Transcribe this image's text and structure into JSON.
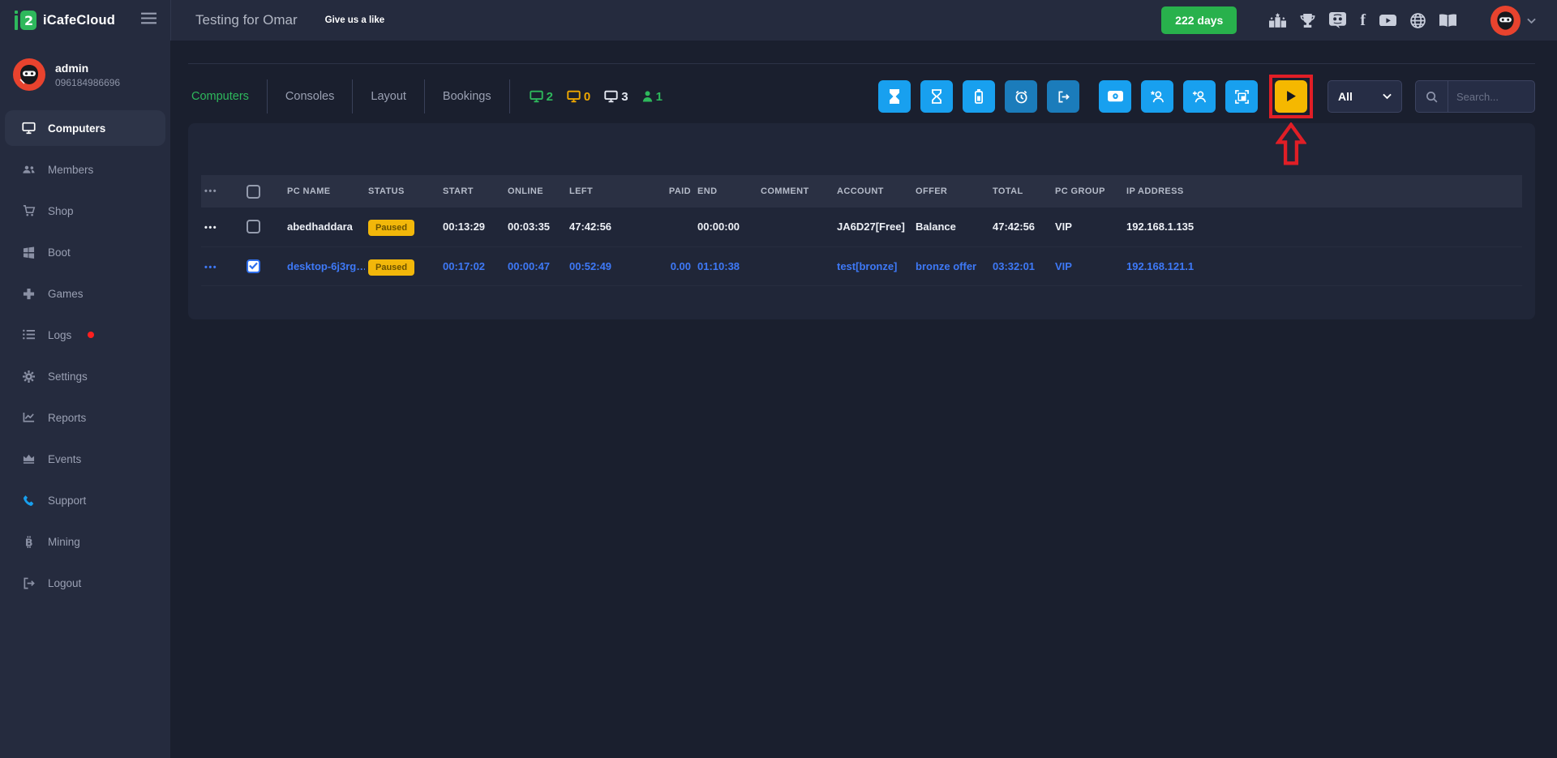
{
  "brand": {
    "name": "iCafeCloud"
  },
  "header": {
    "title": "Testing for Omar",
    "like": "Give us a like",
    "days_badge": "222 days",
    "social_icons": [
      "ranking",
      "trophy",
      "discord",
      "facebook",
      "youtube",
      "globe",
      "guide-book"
    ]
  },
  "user": {
    "name": "admin",
    "phone": "096184986696"
  },
  "sidebar": [
    {
      "label": "Computers",
      "icon": "monitor",
      "active": true
    },
    {
      "label": "Members",
      "icon": "people"
    },
    {
      "label": "Shop",
      "icon": "cart"
    },
    {
      "label": "Boot",
      "icon": "windows"
    },
    {
      "label": "Games",
      "icon": "gamepad"
    },
    {
      "label": "Logs",
      "icon": "list",
      "alert": true
    },
    {
      "label": "Settings",
      "icon": "gear"
    },
    {
      "label": "Reports",
      "icon": "chart"
    },
    {
      "label": "Events",
      "icon": "crown"
    },
    {
      "label": "Support",
      "icon": "phone"
    },
    {
      "label": "Mining",
      "icon": "bitcoin"
    },
    {
      "label": "Logout",
      "icon": "sign-out"
    }
  ],
  "tabs": [
    {
      "label": "Computers",
      "active": true
    },
    {
      "label": "Consoles",
      "active": false
    },
    {
      "label": "Layout",
      "active": false
    },
    {
      "label": "Bookings",
      "active": false
    }
  ],
  "counters": {
    "on": "2",
    "idle": "0",
    "off": "3",
    "users": "1"
  },
  "toolbar": {
    "buttons": [
      "hourglass-filled",
      "hourglass",
      "battery",
      "alarm",
      "sign-out",
      "cash",
      "member-star",
      "member-add",
      "screen-frame",
      "play"
    ],
    "highlighted_button": "play",
    "filter_value": "All",
    "search_placeholder": "Search..."
  },
  "table": {
    "headers": {
      "pc_name": "PC NAME",
      "status": "STATUS",
      "start": "START",
      "online": "ONLINE",
      "left": "LEFT",
      "paid": "PAID",
      "end": "END",
      "comment": "COMMENT",
      "account": "ACCOUNT",
      "offer": "OFFER",
      "total": "TOTAL",
      "pc_group": "PC GROUP",
      "ip": "IP ADDRESS"
    },
    "rows": [
      {
        "pc_name": "abedhaddara",
        "status": "Paused",
        "start": "00:13:29",
        "online": "00:03:35",
        "left": "47:42:56",
        "paid": "",
        "end": "00:00:00",
        "comment": "",
        "account": "JA6D27[Free]",
        "offer": "Balance",
        "total": "47:42:56",
        "pc_group": "VIP",
        "ip": "192.168.1.135",
        "selected": false
      },
      {
        "pc_name": "desktop-6j3rg…",
        "status": "Paused",
        "start": "00:17:02",
        "online": "00:00:47",
        "left": "00:52:49",
        "paid": "0.00",
        "end": "01:10:38",
        "comment": "",
        "account": "test[bronze]",
        "offer": "bronze offer",
        "total": "03:32:01",
        "pc_group": "VIP",
        "ip": "192.168.121.1",
        "selected": true
      }
    ]
  },
  "colors": {
    "green": "#2eb85c",
    "blue": "#18a0ef",
    "blue_dim": "#1b7cbb",
    "yellow": "#f5b800",
    "badge_yellow": "#f2b70a",
    "red": "#e11e26",
    "link_blue": "#3e79f7",
    "avatar_red": "#e8432e"
  }
}
